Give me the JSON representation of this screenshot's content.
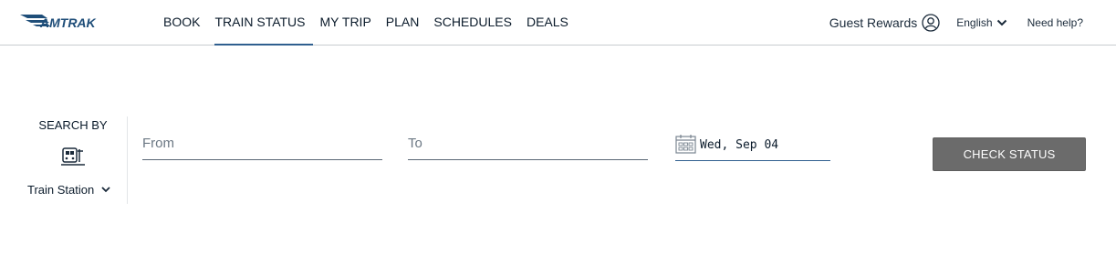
{
  "header": {
    "logo_text": "AMTRAK",
    "nav": [
      {
        "label": "BOOK",
        "active": false
      },
      {
        "label": "TRAIN STATUS",
        "active": true
      },
      {
        "label": "MY TRIP",
        "active": false
      },
      {
        "label": "PLAN",
        "active": false
      },
      {
        "label": "SCHEDULES",
        "active": false
      },
      {
        "label": "DEALS",
        "active": false
      }
    ],
    "rewards_label": "Guest Rewards",
    "language": "English",
    "help": "Need help?"
  },
  "search": {
    "search_by_label": "SEARCH BY",
    "search_by_value": "Train Station",
    "from_placeholder": "From",
    "to_placeholder": "To",
    "date": "Wed, Sep 04",
    "submit_label": "CHECK STATUS"
  },
  "colors": {
    "brand": "#1f4e79",
    "active_underline": "#2f5f8f",
    "button_bg": "#6b6b6b",
    "text": "#1a2a3a"
  },
  "icons": {
    "account": "user-circle-icon",
    "language": "chevron-down-icon",
    "station": "train-station-icon",
    "date": "calendar-icon"
  }
}
